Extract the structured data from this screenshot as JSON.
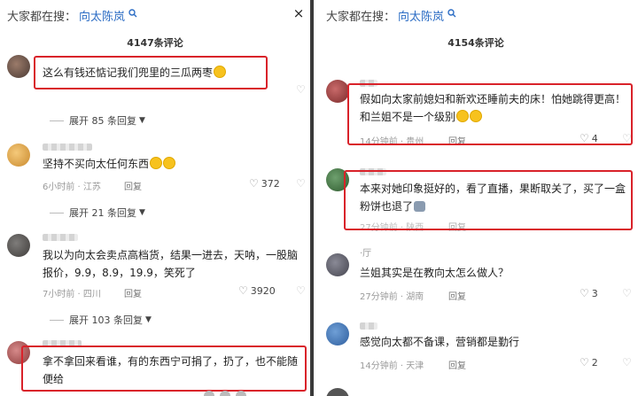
{
  "left": {
    "search_prefix": "大家都在搜：",
    "search_term": "向太陈岚",
    "close_icon": "×",
    "comment_count": "4147条评论",
    "comments": [
      {
        "text": "这么有钱还惦记我们兜里的三瓜两枣",
        "emoji": "smiling-face"
      },
      {
        "text": "坚持不买向太任何东西",
        "meta": "6小时前 · 江苏",
        "reply": "回复",
        "likes": "372"
      },
      {
        "text": "我以为向太会卖点高档货，结果一进去，天呐，一股脑报价，9.9，8.9，19.9，笑死了",
        "meta": "7小时前 · 四川",
        "reply": "回复",
        "likes": "3920"
      },
      {
        "text": "拿不拿回来看谁，有的东西宁可捐了，扔了，也不能随便给"
      }
    ],
    "expand": [
      "展开 85 条回复",
      "展开 21 条回复",
      "展开 103 条回复"
    ]
  },
  "right": {
    "search_prefix": "大家都在搜：",
    "search_term": "向太陈岚",
    "comment_count": "4154条评论",
    "comments": [
      {
        "text": "假如向太家前媳妇和新欢还睡前夫的床！怕她跳得更高！和兰姐不是一个级别",
        "meta": "14分钟前 · 贵州",
        "reply": "回复",
        "likes": "4"
      },
      {
        "text": "本来对她印象挺好的，看了直播，果断取关了，买了一盒粉饼也退了",
        "meta": "27分钟前 · 陕西",
        "reply": "回复"
      },
      {
        "username": "·厅",
        "text": "兰姐其实是在教向太怎么做人？",
        "meta": "27分钟前 · 湖南",
        "reply": "回复",
        "likes": "3"
      },
      {
        "text": "感觉向太都不备课，营销都是勤行",
        "meta": "14分钟前 · 天津",
        "reply": "回复",
        "likes": "2"
      }
    ]
  },
  "colors": {
    "accent": "#2b6cc4",
    "highlight": "#d9222a"
  }
}
